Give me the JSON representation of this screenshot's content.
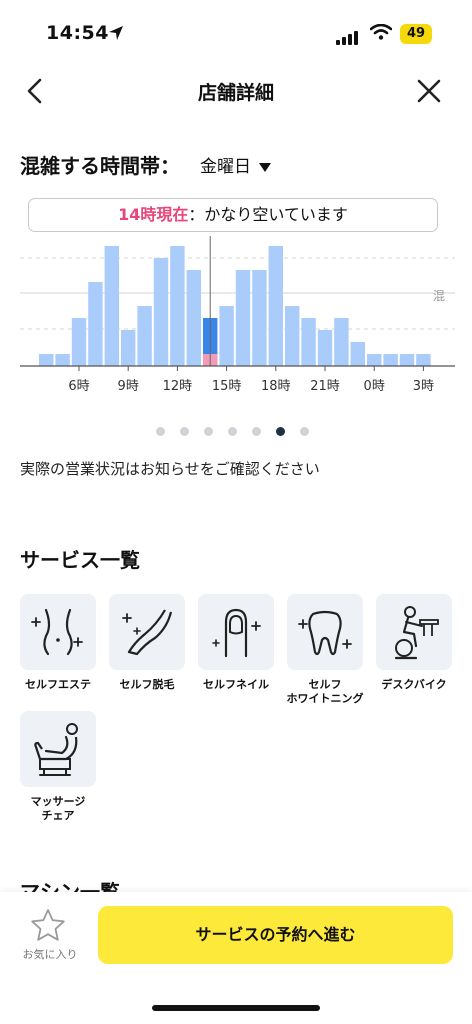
{
  "status_bar": {
    "time": "14:54",
    "battery": "49"
  },
  "header": {
    "title": "店舗詳細"
  },
  "crowd": {
    "title": "混雑する時間帯：",
    "day": "金曜日",
    "now_time": "14時現在",
    "now_status": "：かなり空いています",
    "side_label": "混",
    "notice": "実際の営業状況はお知らせをご確認ください"
  },
  "chart_data": {
    "type": "bar",
    "categories": [
      "4",
      "5",
      "6",
      "7",
      "8",
      "9",
      "10",
      "11",
      "12",
      "13",
      "14",
      "15",
      "16",
      "17",
      "18",
      "19",
      "20",
      "21",
      "22",
      "23",
      "0",
      "1",
      "2",
      "3"
    ],
    "values": [
      1,
      1,
      4,
      7,
      10,
      3,
      5,
      9,
      10,
      8,
      4,
      5,
      8,
      8,
      10,
      5,
      4,
      3,
      4,
      2,
      1,
      1,
      1,
      1
    ],
    "current_index": 10,
    "current_live_value": 1,
    "tick_labels": [
      "6時",
      "9時",
      "12時",
      "15時",
      "18時",
      "21時",
      "0時",
      "3時"
    ],
    "tick_category_index": [
      2,
      5,
      8,
      11,
      14,
      17,
      20,
      23
    ],
    "ylim": [
      0,
      10
    ],
    "colors": {
      "bar": "#a9ccfa",
      "current": "#3a86e8",
      "live": "#f29bb6"
    }
  },
  "pager": {
    "count": 7,
    "active": 5
  },
  "services": {
    "title": "サービス一覧",
    "items": [
      {
        "label": "セルフエステ",
        "icon": "self-esthetic-icon"
      },
      {
        "label": "セルフ脱毛",
        "icon": "self-hair-removal-icon"
      },
      {
        "label": "セルフネイル",
        "icon": "self-nail-icon"
      },
      {
        "label": "セルフ\nホワイトニング",
        "icon": "self-whitening-icon"
      },
      {
        "label": "デスクバイク",
        "icon": "desk-bike-icon"
      },
      {
        "label": "マッサージ\nチェア",
        "icon": "massage-chair-icon"
      }
    ]
  },
  "next_section": {
    "title": "マシン一覧"
  },
  "bottom": {
    "favorite": "お気に入り",
    "reserve": "サービスの予約へ進む"
  }
}
